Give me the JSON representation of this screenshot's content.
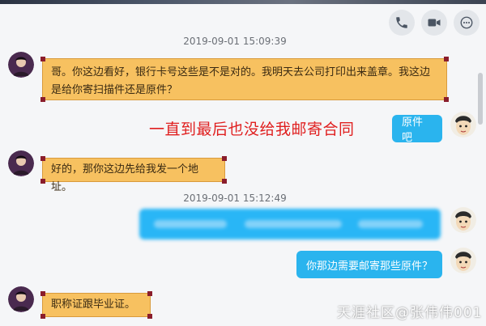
{
  "toolbar": {
    "icons": [
      "phone-icon",
      "video-icon",
      "more-icon"
    ]
  },
  "timestamps": [
    "2019-09-01 15:09:39",
    "2019-09-01 15:12:49"
  ],
  "messages": {
    "m1": "哥。你这边看好，银行卡号这些是不是对的。我明天去公司打印出来盖章。我这边是给你寄扫描件还是原件？",
    "m2": "原件吧",
    "m3": "好的，那你这边先给我发一个地址。",
    "m5": "你那边需要邮寄那些原件？",
    "m6": "职称证跟毕业证。"
  },
  "annotation": "一直到最后也没给我邮寄合同",
  "watermark": "天涯社区@张伟伟001",
  "colors": {
    "yellow_bubble": "#f7c160",
    "blue_bubble": "#2ab4ee",
    "annotation_red": "#e01f1f"
  }
}
